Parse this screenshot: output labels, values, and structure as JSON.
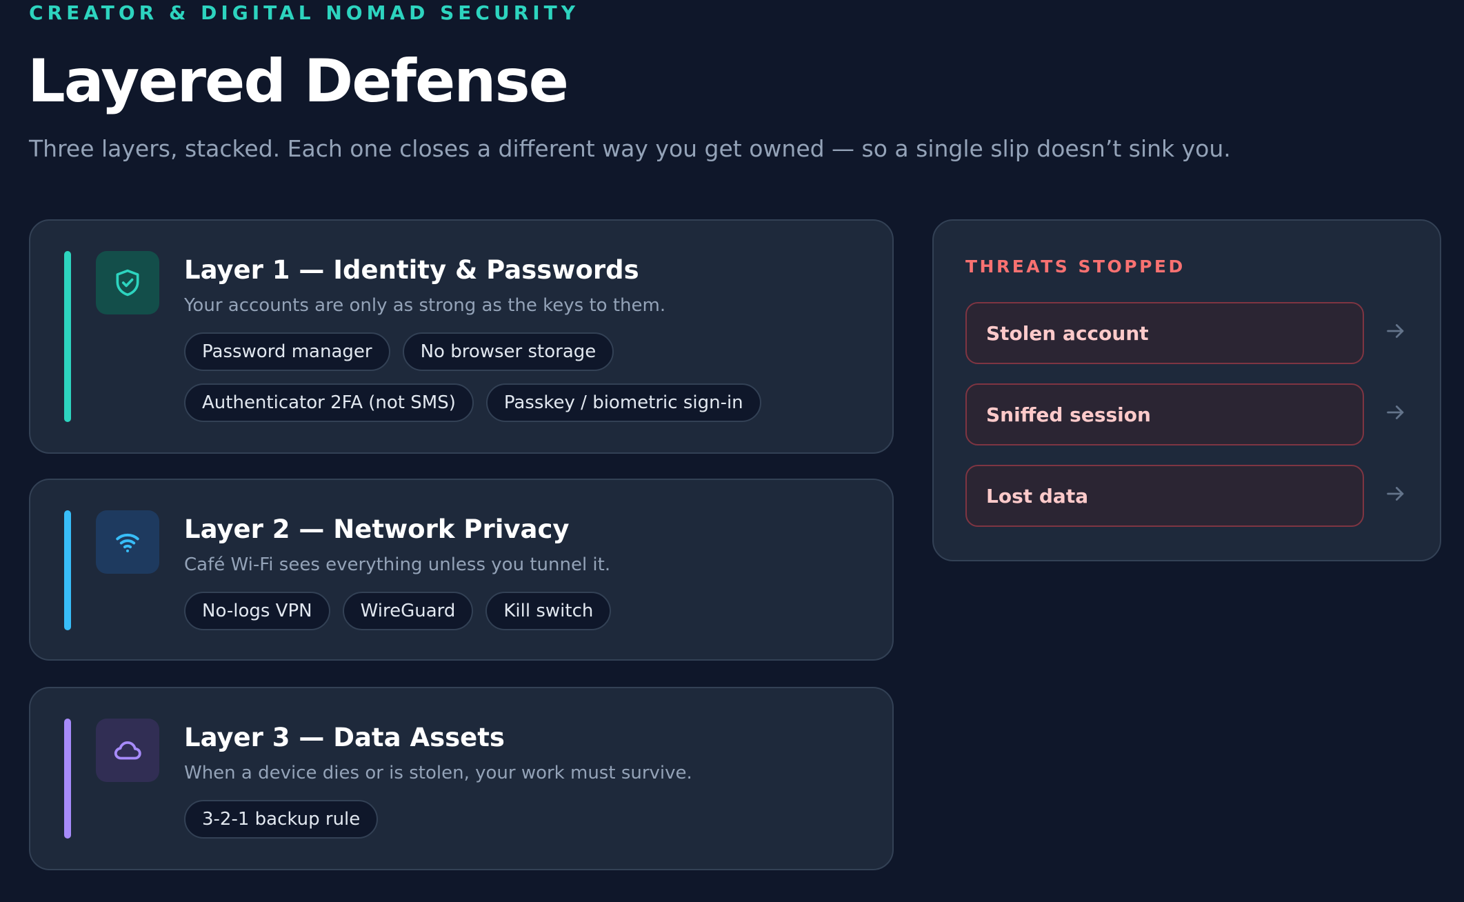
{
  "header": {
    "eyebrow": "CREATOR & DIGITAL NOMAD SECURITY",
    "title": "Layered Defense",
    "subtitle": "Three layers, stacked. Each one closes a different way you get owned — so a single slip doesn’t sink you."
  },
  "layers": [
    {
      "title": "Layer 1 — Identity & Passwords",
      "description": "Your accounts are only as strong as the keys to them.",
      "icon": "shield-check-icon",
      "accent_color": "#2dd4bf",
      "icon_bg": "#134e4a",
      "tags": [
        "Password manager",
        "No browser storage",
        "Authenticator 2FA (not SMS)",
        "Passkey / biometric sign-in"
      ]
    },
    {
      "title": "Layer 2 — Network Privacy",
      "description": "Café Wi-Fi sees everything unless you tunnel it.",
      "icon": "wifi-icon",
      "accent_color": "#38bdf8",
      "icon_bg": "#1e3a5f",
      "tags": [
        "No-logs VPN",
        "WireGuard",
        "Kill switch"
      ]
    },
    {
      "title": "Layer 3 — Data Assets",
      "description": "When a device dies or is stolen, your work must survive.",
      "icon": "cloud-icon",
      "accent_color": "#a78bfa",
      "icon_bg": "#312e54",
      "tags": [
        "3-2-1 backup rule"
      ]
    }
  ],
  "threats": {
    "label": "THREATS STOPPED",
    "accent_color": "#f87171",
    "items": [
      "Stolen account",
      "Sniffed session",
      "Lost data"
    ],
    "arrow_icon": "arrow-right-icon"
  }
}
